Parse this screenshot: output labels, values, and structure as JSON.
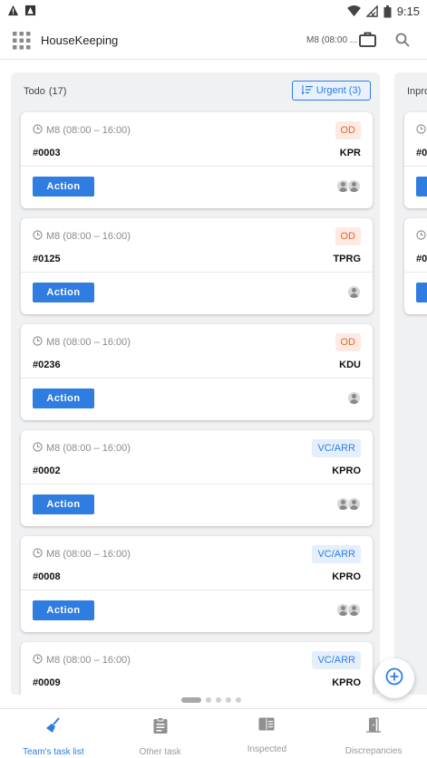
{
  "status_bar": {
    "time": "9:15"
  },
  "app_bar": {
    "title": "HouseKeeping",
    "shift": "M8 (08:00 ..."
  },
  "columns": [
    {
      "name": "Todo",
      "count": "(17)",
      "urgent_label": "Urgent (3)",
      "cards": [
        {
          "time": "M8 (08:00 – 16:00)",
          "badge": "OD",
          "room": "#0003",
          "code": "KPR",
          "action": "Action",
          "assignees": 2
        },
        {
          "time": "M8 (08:00 – 16:00)",
          "badge": "OD",
          "room": "#0125",
          "code": "TPRG",
          "action": "Action",
          "assignees": 1
        },
        {
          "time": "M8 (08:00 – 16:00)",
          "badge": "OD",
          "room": "#0236",
          "code": "KDU",
          "action": "Action",
          "assignees": 1
        },
        {
          "time": "M8 (08:00 – 16:00)",
          "badge": "VC/ARR",
          "room": "#0002",
          "code": "KPRO",
          "action": "Action",
          "assignees": 2
        },
        {
          "time": "M8 (08:00 – 16:00)",
          "badge": "VC/ARR",
          "room": "#0008",
          "code": "KPRO",
          "action": "Action",
          "assignees": 2
        },
        {
          "time": "M8 (08:00 – 16:00)",
          "badge": "VC/ARR",
          "room": "#0009",
          "code": "KPRO",
          "action": "Action",
          "assignees": 2
        }
      ]
    },
    {
      "name": "Inpro",
      "cards": [
        {
          "room": "#0"
        },
        {
          "room": "#0"
        }
      ]
    }
  ],
  "pager": {
    "pages": 5,
    "active": 0
  },
  "bottom_nav": [
    {
      "label": "Team's task list",
      "icon": "broom-icon",
      "active": true
    },
    {
      "label": "Other task",
      "icon": "clipboard-icon",
      "active": false
    },
    {
      "label": "Inspected",
      "icon": "book-icon",
      "active": false
    },
    {
      "label": "Discrepancies",
      "icon": "door-icon",
      "active": false
    }
  ],
  "colors": {
    "accent": "#2f7de1",
    "od_badge": "#e8632b",
    "vc_badge": "#2f7de1"
  }
}
